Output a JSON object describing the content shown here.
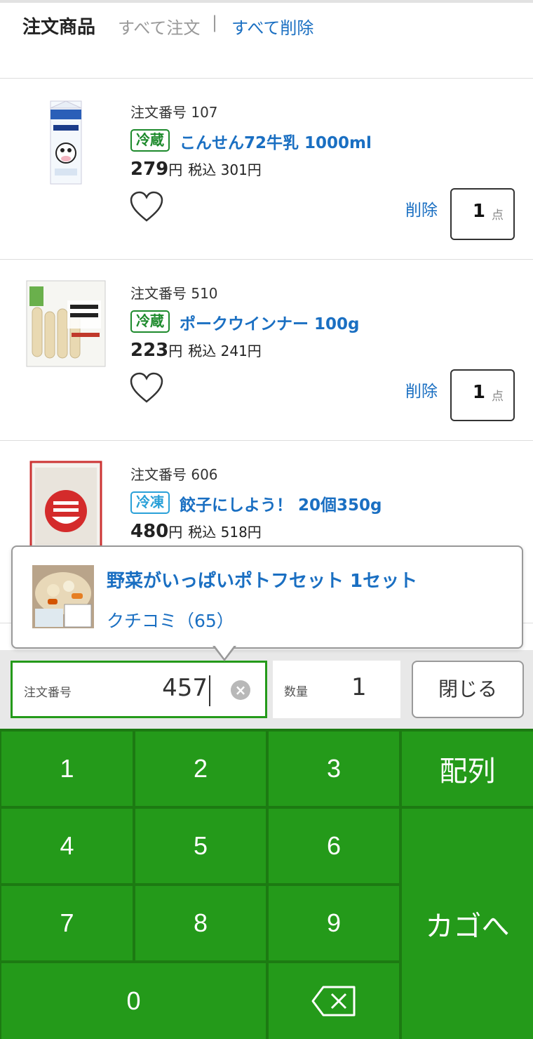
{
  "header": {
    "title": "注文商品",
    "order_all": "すべて注文",
    "separator": "|",
    "delete_all": "すべて削除"
  },
  "items": [
    {
      "order_label": "注文番号 107",
      "storage": "冷蔵",
      "name": "こんせん72牛乳 1000ml",
      "price": "279",
      "yen": "円",
      "tax_price": "税込 301円",
      "delete": "削除",
      "qty": "1",
      "unit": "点"
    },
    {
      "order_label": "注文番号 510",
      "storage": "冷蔵",
      "name": "ポークウインナー 100g",
      "price": "223",
      "yen": "円",
      "tax_price": "税込 241円",
      "delete": "削除",
      "qty": "1",
      "unit": "点"
    },
    {
      "order_label": "注文番号 606",
      "storage": "冷凍",
      "name": "餃子にしよう！ 20個350g",
      "price": "480",
      "yen": "円",
      "tax_price": "税込 518円"
    }
  ],
  "popup": {
    "name": "野菜がいっぱいポトフセット 1セット",
    "reviews": "クチコミ（65）"
  },
  "input": {
    "order_label": "注文番号",
    "order_value": "457",
    "qty_label": "数量",
    "qty_value": "1",
    "close": "閉じる"
  },
  "keypad": {
    "k1": "1",
    "k2": "2",
    "k3": "3",
    "k4": "4",
    "k5": "5",
    "k6": "6",
    "k7": "7",
    "k8": "8",
    "k9": "9",
    "k0": "0",
    "layout": "配列",
    "to_cart": "カゴへ"
  },
  "colors": {
    "link_blue": "#1a6fc2",
    "chilled_green": "#1d8a2c",
    "frozen_blue": "#29a0d8",
    "keypad_green": "#249a1a"
  }
}
